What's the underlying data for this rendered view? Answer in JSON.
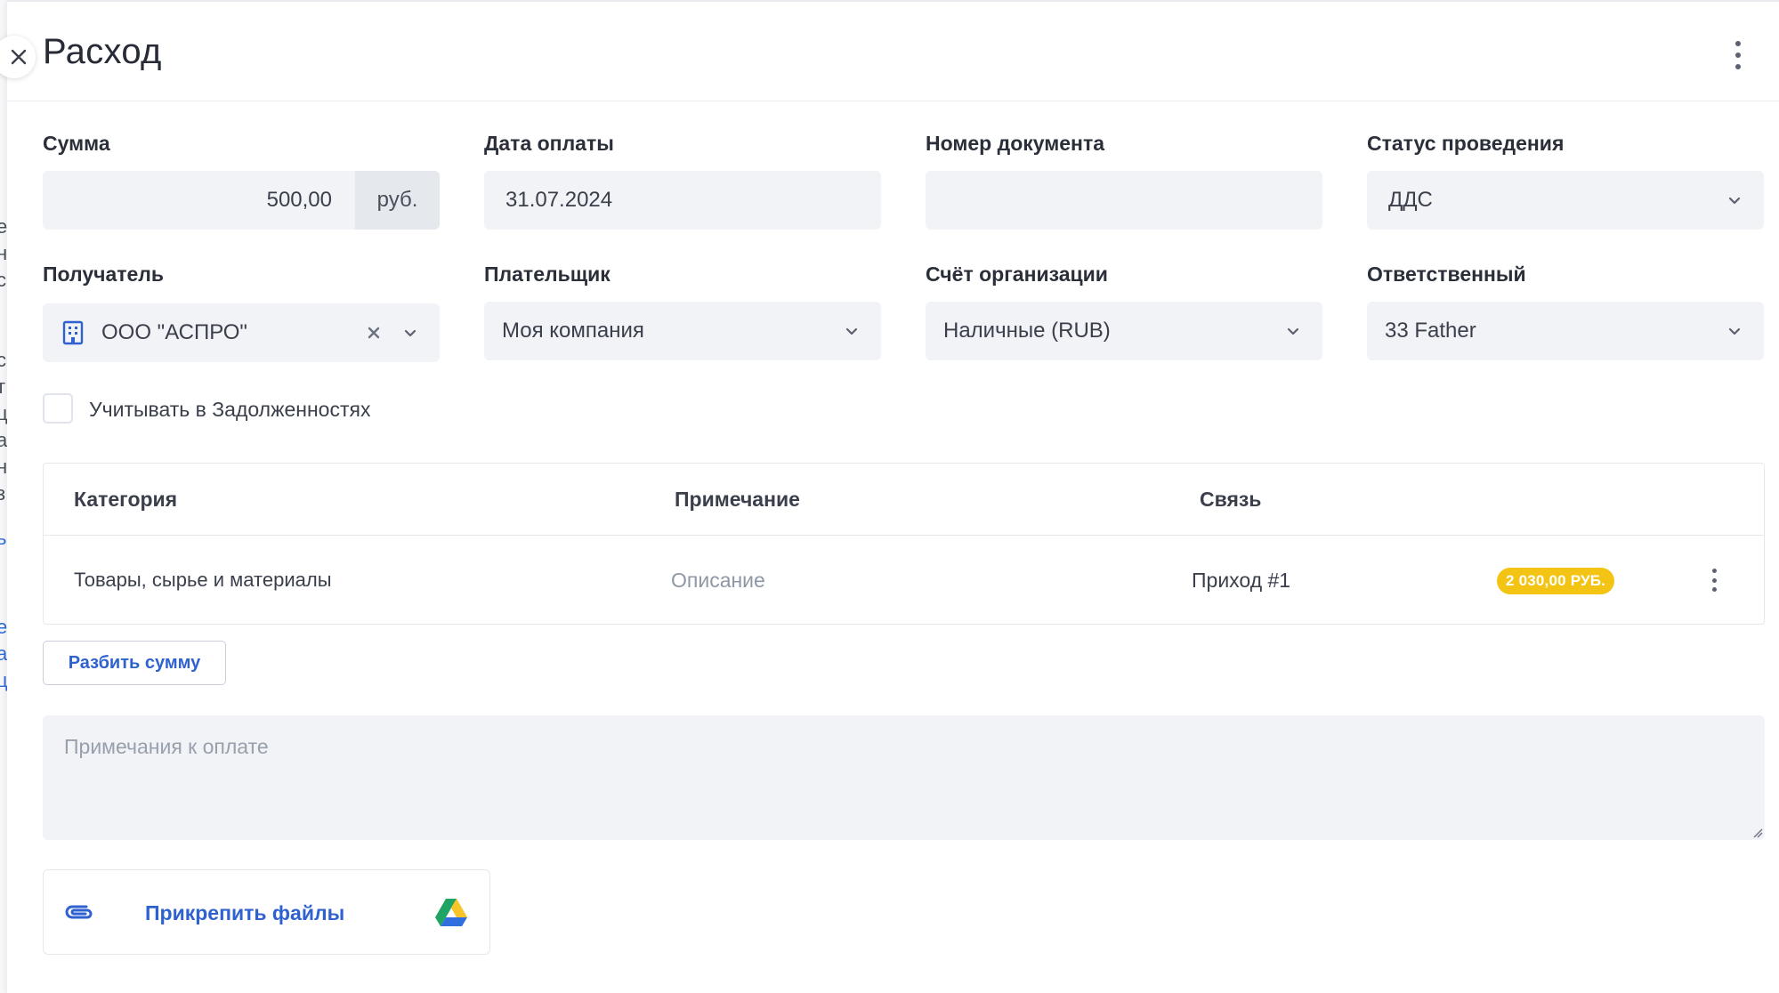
{
  "header": {
    "title": "Расход"
  },
  "fields": {
    "amount": {
      "label": "Сумма",
      "value": "500,00",
      "unit": "руб."
    },
    "payment_date": {
      "label": "Дата оплаты",
      "value": "31.07.2024"
    },
    "document_number": {
      "label": "Номер документа",
      "value": ""
    },
    "status": {
      "label": "Статус проведения",
      "value": "ДДС"
    },
    "recipient": {
      "label": "Получатель",
      "value": "ООО \"АСПРО\""
    },
    "payer": {
      "label": "Плательщик",
      "value": "Моя компания"
    },
    "account": {
      "label": "Счёт организации",
      "value": "Наличные (RUB)"
    },
    "responsible": {
      "label": "Ответственный",
      "value": "33 Father"
    }
  },
  "debts_checkbox": {
    "label": "Учитывать в Задолженностях",
    "checked": false
  },
  "table": {
    "columns": [
      "Категория",
      "Примечание",
      "Связь"
    ],
    "rows": [
      {
        "category": "Товары, сырье и материалы",
        "note_placeholder": "Описание",
        "link": "Приход #1",
        "badge": "2 030,00 РУБ."
      }
    ]
  },
  "split_button": {
    "label": "Разбить сумму"
  },
  "notes": {
    "placeholder": "Примечания к оплате"
  },
  "attach": {
    "label": "Прикрепить файлы"
  },
  "colors": {
    "accent": "#2f62cf",
    "badge": "#f3c413",
    "field_bg": "#f1f3f6"
  },
  "icons": [
    "close-icon",
    "kebab-icon",
    "chevron-down-icon",
    "building-icon",
    "clear-icon",
    "paperclip-icon",
    "google-drive-icon"
  ]
}
